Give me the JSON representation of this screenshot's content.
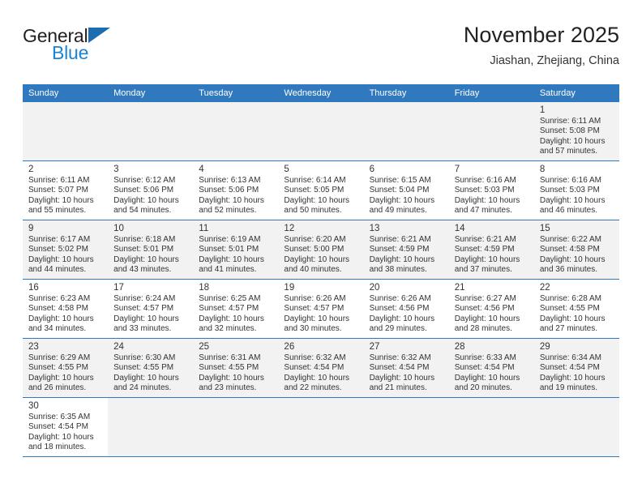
{
  "brand": {
    "name_top": "General",
    "name_bottom": "Blue",
    "triangle_icon": "triangle-logo-icon",
    "color_dark": "#231f20",
    "color_blue": "#1b83d4"
  },
  "header": {
    "title": "November 2025",
    "subtitle": "Jiashan, Zhejiang, China"
  },
  "theme": {
    "header_bg": "#3179bf",
    "header_text": "#ffffff",
    "shaded_cell_bg": "#f2f2f2",
    "grid_line": "#3179bf"
  },
  "weekdays": [
    "Sunday",
    "Monday",
    "Tuesday",
    "Wednesday",
    "Thursday",
    "Friday",
    "Saturday"
  ],
  "weeks": [
    [
      {
        "day": "",
        "info": "",
        "empty": true
      },
      {
        "day": "",
        "info": "",
        "empty": true
      },
      {
        "day": "",
        "info": "",
        "empty": true
      },
      {
        "day": "",
        "info": "",
        "empty": true
      },
      {
        "day": "",
        "info": "",
        "empty": true
      },
      {
        "day": "",
        "info": "",
        "empty": true
      },
      {
        "day": "1",
        "info": "Sunrise: 6:11 AM\nSunset: 5:08 PM\nDaylight: 10 hours\nand 57 minutes.",
        "empty": false
      }
    ],
    [
      {
        "day": "2",
        "info": "Sunrise: 6:11 AM\nSunset: 5:07 PM\nDaylight: 10 hours\nand 55 minutes.",
        "empty": false
      },
      {
        "day": "3",
        "info": "Sunrise: 6:12 AM\nSunset: 5:06 PM\nDaylight: 10 hours\nand 54 minutes.",
        "empty": false
      },
      {
        "day": "4",
        "info": "Sunrise: 6:13 AM\nSunset: 5:06 PM\nDaylight: 10 hours\nand 52 minutes.",
        "empty": false
      },
      {
        "day": "5",
        "info": "Sunrise: 6:14 AM\nSunset: 5:05 PM\nDaylight: 10 hours\nand 50 minutes.",
        "empty": false
      },
      {
        "day": "6",
        "info": "Sunrise: 6:15 AM\nSunset: 5:04 PM\nDaylight: 10 hours\nand 49 minutes.",
        "empty": false
      },
      {
        "day": "7",
        "info": "Sunrise: 6:16 AM\nSunset: 5:03 PM\nDaylight: 10 hours\nand 47 minutes.",
        "empty": false
      },
      {
        "day": "8",
        "info": "Sunrise: 6:16 AM\nSunset: 5:03 PM\nDaylight: 10 hours\nand 46 minutes.",
        "empty": false
      }
    ],
    [
      {
        "day": "9",
        "info": "Sunrise: 6:17 AM\nSunset: 5:02 PM\nDaylight: 10 hours\nand 44 minutes.",
        "empty": false
      },
      {
        "day": "10",
        "info": "Sunrise: 6:18 AM\nSunset: 5:01 PM\nDaylight: 10 hours\nand 43 minutes.",
        "empty": false
      },
      {
        "day": "11",
        "info": "Sunrise: 6:19 AM\nSunset: 5:01 PM\nDaylight: 10 hours\nand 41 minutes.",
        "empty": false
      },
      {
        "day": "12",
        "info": "Sunrise: 6:20 AM\nSunset: 5:00 PM\nDaylight: 10 hours\nand 40 minutes.",
        "empty": false
      },
      {
        "day": "13",
        "info": "Sunrise: 6:21 AM\nSunset: 4:59 PM\nDaylight: 10 hours\nand 38 minutes.",
        "empty": false
      },
      {
        "day": "14",
        "info": "Sunrise: 6:21 AM\nSunset: 4:59 PM\nDaylight: 10 hours\nand 37 minutes.",
        "empty": false
      },
      {
        "day": "15",
        "info": "Sunrise: 6:22 AM\nSunset: 4:58 PM\nDaylight: 10 hours\nand 36 minutes.",
        "empty": false
      }
    ],
    [
      {
        "day": "16",
        "info": "Sunrise: 6:23 AM\nSunset: 4:58 PM\nDaylight: 10 hours\nand 34 minutes.",
        "empty": false
      },
      {
        "day": "17",
        "info": "Sunrise: 6:24 AM\nSunset: 4:57 PM\nDaylight: 10 hours\nand 33 minutes.",
        "empty": false
      },
      {
        "day": "18",
        "info": "Sunrise: 6:25 AM\nSunset: 4:57 PM\nDaylight: 10 hours\nand 32 minutes.",
        "empty": false
      },
      {
        "day": "19",
        "info": "Sunrise: 6:26 AM\nSunset: 4:57 PM\nDaylight: 10 hours\nand 30 minutes.",
        "empty": false
      },
      {
        "day": "20",
        "info": "Sunrise: 6:26 AM\nSunset: 4:56 PM\nDaylight: 10 hours\nand 29 minutes.",
        "empty": false
      },
      {
        "day": "21",
        "info": "Sunrise: 6:27 AM\nSunset: 4:56 PM\nDaylight: 10 hours\nand 28 minutes.",
        "empty": false
      },
      {
        "day": "22",
        "info": "Sunrise: 6:28 AM\nSunset: 4:55 PM\nDaylight: 10 hours\nand 27 minutes.",
        "empty": false
      }
    ],
    [
      {
        "day": "23",
        "info": "Sunrise: 6:29 AM\nSunset: 4:55 PM\nDaylight: 10 hours\nand 26 minutes.",
        "empty": false
      },
      {
        "day": "24",
        "info": "Sunrise: 6:30 AM\nSunset: 4:55 PM\nDaylight: 10 hours\nand 24 minutes.",
        "empty": false
      },
      {
        "day": "25",
        "info": "Sunrise: 6:31 AM\nSunset: 4:55 PM\nDaylight: 10 hours\nand 23 minutes.",
        "empty": false
      },
      {
        "day": "26",
        "info": "Sunrise: 6:32 AM\nSunset: 4:54 PM\nDaylight: 10 hours\nand 22 minutes.",
        "empty": false
      },
      {
        "day": "27",
        "info": "Sunrise: 6:32 AM\nSunset: 4:54 PM\nDaylight: 10 hours\nand 21 minutes.",
        "empty": false
      },
      {
        "day": "28",
        "info": "Sunrise: 6:33 AM\nSunset: 4:54 PM\nDaylight: 10 hours\nand 20 minutes.",
        "empty": false
      },
      {
        "day": "29",
        "info": "Sunrise: 6:34 AM\nSunset: 4:54 PM\nDaylight: 10 hours\nand 19 minutes.",
        "empty": false
      }
    ],
    [
      {
        "day": "30",
        "info": "Sunrise: 6:35 AM\nSunset: 4:54 PM\nDaylight: 10 hours\nand 18 minutes.",
        "empty": false
      },
      {
        "day": "",
        "info": "",
        "empty": true
      },
      {
        "day": "",
        "info": "",
        "empty": true
      },
      {
        "day": "",
        "info": "",
        "empty": true
      },
      {
        "day": "",
        "info": "",
        "empty": true
      },
      {
        "day": "",
        "info": "",
        "empty": true
      },
      {
        "day": "",
        "info": "",
        "empty": true
      }
    ]
  ]
}
